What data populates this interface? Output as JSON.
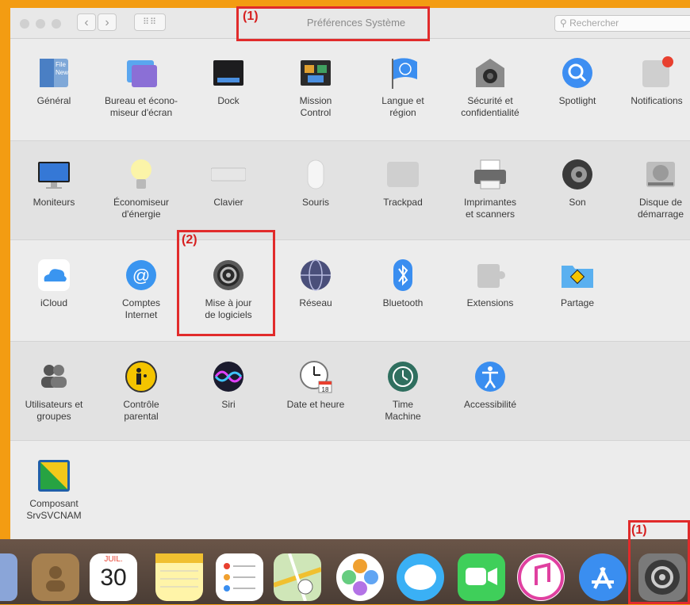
{
  "window": {
    "title": "Préférences Système",
    "search_placeholder": "Rechercher"
  },
  "annotations": {
    "marker1": "(1)",
    "marker2": "(2)",
    "marker1_dock": "(1)"
  },
  "rows": [
    [
      {
        "label": "Général",
        "icon": "general-icon"
      },
      {
        "label": "Bureau et écono-\nmiseur d'écran",
        "icon": "desktop-icon"
      },
      {
        "label": "Dock",
        "icon": "dock-icon"
      },
      {
        "label": "Mission\nControl",
        "icon": "mission-control-icon"
      },
      {
        "label": "Langue et\nrégion",
        "icon": "flag-icon"
      },
      {
        "label": "Sécurité et\nconfidentialité",
        "icon": "security-icon"
      },
      {
        "label": "Spotlight",
        "icon": "search-icon"
      },
      {
        "label": "Notifications",
        "icon": "notifications-icon"
      }
    ],
    [
      {
        "label": "Moniteurs",
        "icon": "monitor-icon"
      },
      {
        "label": "Économiseur\nd'énergie",
        "icon": "bulb-icon"
      },
      {
        "label": "Clavier",
        "icon": "keyboard-icon"
      },
      {
        "label": "Souris",
        "icon": "mouse-icon"
      },
      {
        "label": "Trackpad",
        "icon": "trackpad-icon"
      },
      {
        "label": "Imprimantes\net scanners",
        "icon": "printer-icon"
      },
      {
        "label": "Son",
        "icon": "speaker-icon"
      },
      {
        "label": "Disque de\ndémarrage",
        "icon": "disk-icon"
      }
    ],
    [
      {
        "label": "iCloud",
        "icon": "icloud-icon"
      },
      {
        "label": "Comptes\nInternet",
        "icon": "at-icon"
      },
      {
        "label": "Mise à jour\nde logiciels",
        "icon": "software-update-icon"
      },
      {
        "label": "Réseau",
        "icon": "network-icon"
      },
      {
        "label": "Bluetooth",
        "icon": "bluetooth-icon"
      },
      {
        "label": "Extensions",
        "icon": "extensions-icon"
      },
      {
        "label": "Partage",
        "icon": "sharing-icon"
      }
    ],
    [
      {
        "label": "Utilisateurs et\ngroupes",
        "icon": "users-icon"
      },
      {
        "label": "Contrôle\nparental",
        "icon": "parental-icon"
      },
      {
        "label": "Siri",
        "icon": "siri-icon"
      },
      {
        "label": "Date et heure",
        "icon": "clock-icon"
      },
      {
        "label": "Time\nMachine",
        "icon": "time-machine-icon"
      },
      {
        "label": "Accessibilité",
        "icon": "accessibility-icon"
      }
    ],
    [
      {
        "label": "Composant\nSrvSVCNAM",
        "icon": "composant-icon"
      }
    ]
  ],
  "calendar": {
    "month": "JUIL.",
    "day": "30"
  },
  "clock_day": "18",
  "dock": [
    {
      "name": "contacts"
    },
    {
      "name": "calendar"
    },
    {
      "name": "notes"
    },
    {
      "name": "reminders"
    },
    {
      "name": "maps"
    },
    {
      "name": "photos"
    },
    {
      "name": "messages"
    },
    {
      "name": "facetime"
    },
    {
      "name": "itunes"
    },
    {
      "name": "app-store"
    },
    {
      "name": "system-preferences"
    }
  ]
}
